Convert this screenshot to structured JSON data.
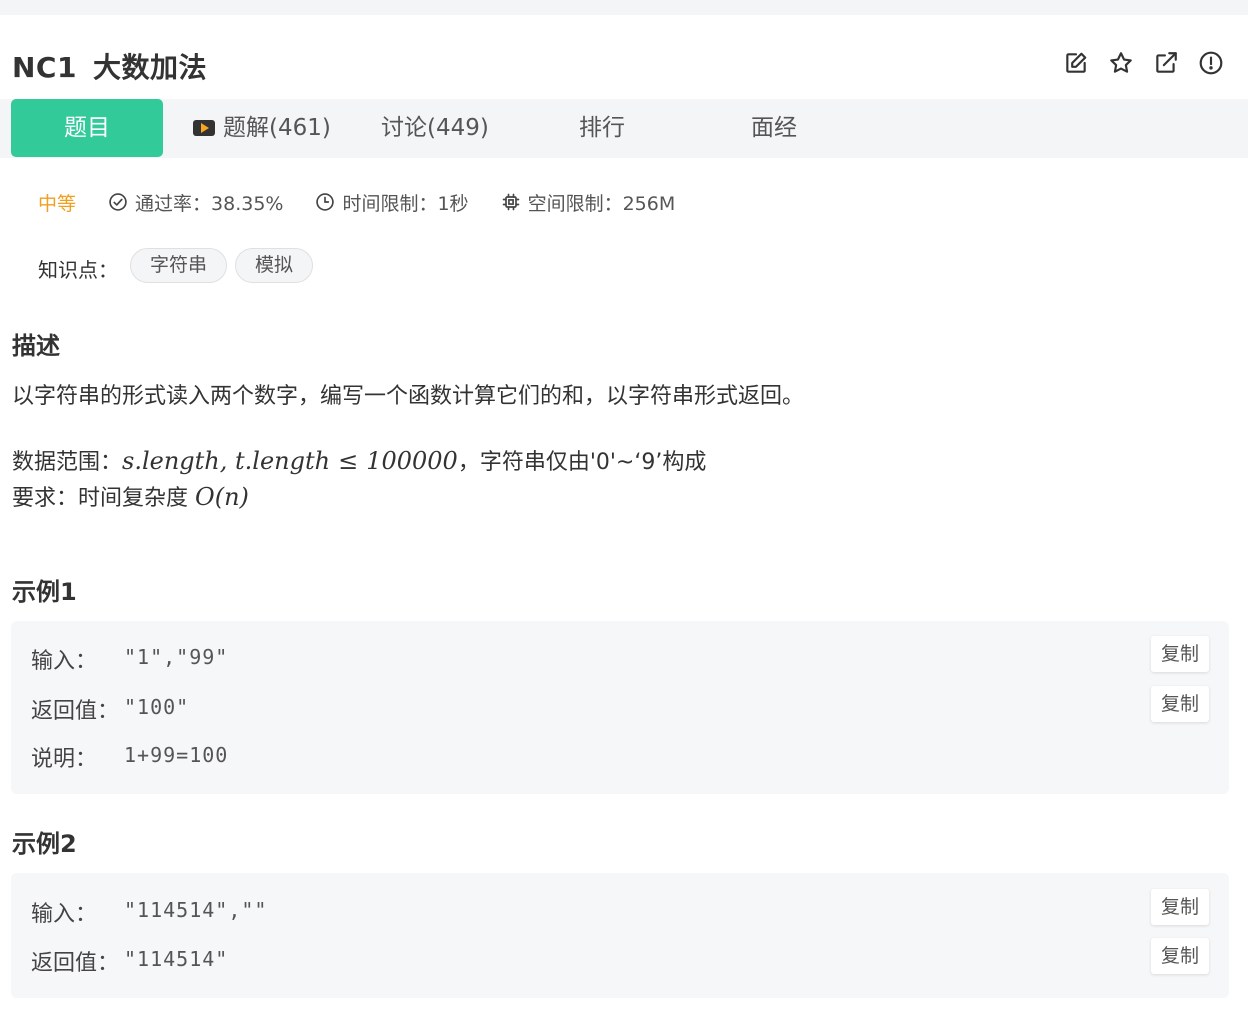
{
  "problem": {
    "code": "NC1",
    "title": "大数加法"
  },
  "actions": [
    {
      "icon": "edit-icon"
    },
    {
      "icon": "star-icon"
    },
    {
      "icon": "external-link-icon"
    },
    {
      "icon": "report-icon"
    }
  ],
  "tabs": {
    "problem": "题目",
    "solutions": "题解(461)",
    "discussion": "讨论(449)",
    "ranking": "排行",
    "interview": "面经"
  },
  "meta": {
    "difficulty": "中等",
    "pass_rate": "通过率：38.35%",
    "time_limit": "时间限制：1秒",
    "space_limit": "空间限制：256M"
  },
  "knowledge": {
    "label": "知识点：",
    "tags": [
      "字符串",
      "模拟"
    ]
  },
  "description": {
    "heading": "描述",
    "text": "以字符串的形式读入两个数字，编写一个函数计算它们的和，以字符串形式返回。",
    "range_prefix": "数据范围：",
    "range_math_a": "s.length, t.length",
    "range_math_le": "≤",
    "range_math_b": "100000",
    "range_suffix": "，字符串仅由'0'~‘9’构成",
    "req_prefix": "要求：时间复杂度 ",
    "req_math_o": "O",
    "req_math_paren_open": "(",
    "req_math_n": "n",
    "req_math_paren_close": ")"
  },
  "examples": [
    {
      "heading": "示例1",
      "input_label": "输入：",
      "input": "\"1\",\"99\"",
      "output_label": "返回值：",
      "output": "\"100\"",
      "explain_label": "说明：",
      "explain": "1+99=100",
      "copy": "复制"
    },
    {
      "heading": "示例2",
      "input_label": "输入：",
      "input": "\"114514\",\"\"",
      "output_label": "返回值：",
      "output": "\"114514\"",
      "copy": "复制"
    }
  ],
  "colors": {
    "accent": "#32ca99",
    "difficulty": "#f0a020",
    "panel_bg": "#f4f5f7"
  }
}
